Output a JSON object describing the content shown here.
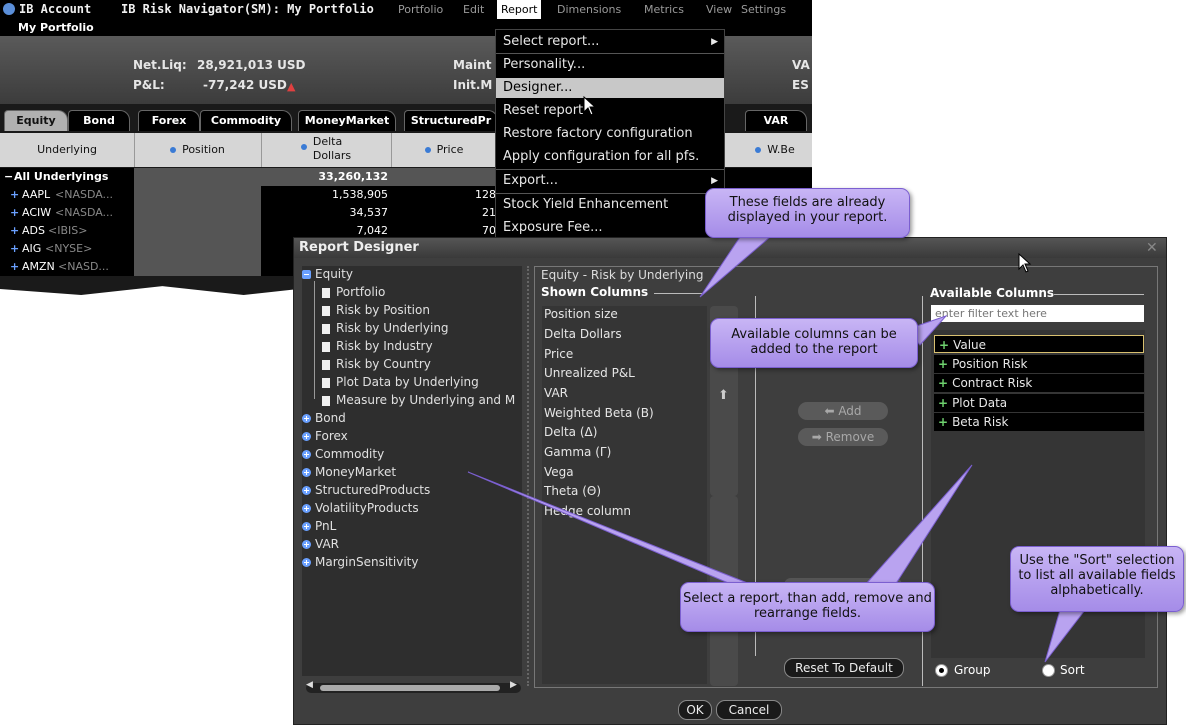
{
  "main_window": {
    "title_app": "IB Account",
    "title_doc": "IB Risk Navigator(SM): My Portfolio",
    "menu": [
      "Portfolio",
      "Edit",
      "Report",
      "Dimensions",
      "Metrics",
      "View",
      "Settings"
    ],
    "subtitle": "My Portfolio",
    "summary": {
      "netliq_label": "Net.Liq:",
      "netliq_value": "28,921,013 USD",
      "pnl_label": "P&L:",
      "pnl_value": "-77,242 USD",
      "maint_label": "Maint",
      "initm_label": "Init.M",
      "va_label": "VA",
      "es_label": "ES"
    },
    "tabs": [
      "Equity",
      "Bond",
      "Forex",
      "Commodity",
      "MoneyMarket",
      "StructuredPr",
      "VAR"
    ],
    "columns": {
      "underlying": "Underlying",
      "position": "Position",
      "delta_dollars_1": "Delta",
      "delta_dollars_2": "Dollars",
      "price": "Price",
      "wbeta": "W.Be"
    },
    "rows": [
      {
        "name": "All Underlyings",
        "exch": "",
        "delta": "33,260,132",
        "price": ""
      },
      {
        "name": "AAPL",
        "exch": "<NASDA...",
        "delta": "1,538,905",
        "price": "128"
      },
      {
        "name": "ACIW",
        "exch": "<NASDA...",
        "delta": "34,537",
        "price": "21"
      },
      {
        "name": "ADS",
        "exch": "<IBIS>",
        "delta": "7,042",
        "price": "70"
      },
      {
        "name": "AIG",
        "exch": "<NYSE>",
        "delta": "",
        "price": ""
      },
      {
        "name": "AMZN",
        "exch": "<NASD...",
        "delta": "",
        "price": ""
      }
    ]
  },
  "report_menu": {
    "items": [
      {
        "label": "Select report...",
        "submenu": true
      },
      {
        "label": "Personality..."
      },
      {
        "label": "Designer..."
      },
      {
        "label": "Reset report"
      },
      {
        "label": "Restore factory configuration"
      },
      {
        "label": "Apply configuration for all pfs."
      },
      {
        "label": "Export...",
        "submenu": true
      },
      {
        "label": "Stock Yield Enhancement"
      },
      {
        "label": "Exposure Fee..."
      }
    ],
    "highlighted": "Designer..."
  },
  "designer": {
    "title": "Report Designer",
    "tree": {
      "root": "Equity",
      "children": [
        "Portfolio",
        "Risk by Position",
        "Risk by Underlying",
        "Risk by Industry",
        "Risk by Country",
        "Plot Data by Underlying",
        "Measure by Underlying and M"
      ],
      "selected": "Risk by Underlying",
      "groups": [
        "Bond",
        "Forex",
        "Commodity",
        "MoneyMarket",
        "StructuredProducts",
        "VolatilityProducts",
        "PnL",
        "VAR",
        "MarginSensitivity"
      ]
    },
    "report_path": "Equity - Risk by Underlying",
    "shown_columns_label": "Shown Columns",
    "shown_columns": [
      "Position size",
      "Delta Dollars",
      "Price",
      "Unrealized P&L",
      "VAR",
      "Weighted Beta (B)",
      "Delta (Δ)",
      "Gamma (Γ)",
      "Vega",
      "Theta (Θ)",
      "Hedge column"
    ],
    "add_label": "Add",
    "remove_label": "Remove",
    "reset_label": "Reset To Default",
    "available_columns_label": "Available Columns",
    "filter_placeholder": "enter filter text here",
    "available_columns": [
      "Value",
      "Position Risk",
      "Contract Risk",
      "Plot Data",
      "Beta Risk"
    ],
    "group_label": "Group",
    "sort_label": "Sort",
    "ok_label": "OK",
    "cancel_label": "Cancel"
  },
  "callouts": {
    "already_displayed": "These fields are already displayed in your report.",
    "available_add": "Available columns can be added to the report",
    "select_report": "Select a report, than add, remove and rearrange fields.",
    "sort_hint": "Use the \"Sort\" selection to list all available fields alphabetically."
  },
  "colors": {
    "accent": "#6aa0ff",
    "callout": "#b9a3f0",
    "dark_bg": "#3e3e3e"
  }
}
